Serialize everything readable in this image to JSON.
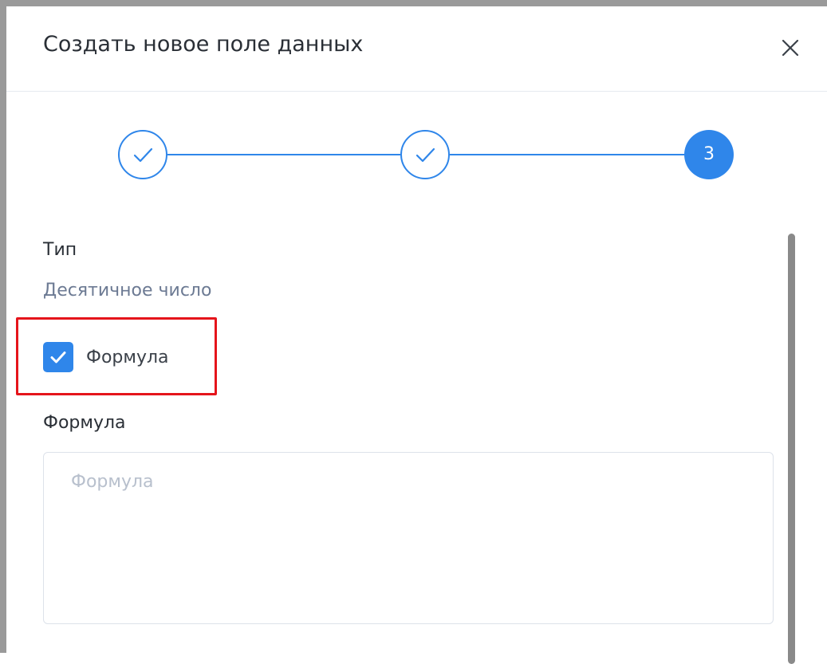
{
  "dialog": {
    "title": "Создать новое поле данных",
    "close_icon": "close-icon"
  },
  "stepper": {
    "steps": [
      {
        "state": "done",
        "icon": "check-icon"
      },
      {
        "state": "done",
        "icon": "check-icon"
      },
      {
        "state": "active",
        "label": "3"
      }
    ],
    "accent_color": "#2f86ea"
  },
  "form": {
    "type_label": "Тип",
    "type_value": "Десятичное число",
    "formula_checkbox": {
      "label": "Формула",
      "checked": true
    },
    "formula_field": {
      "label": "Формула",
      "placeholder": "Формула",
      "value": ""
    }
  },
  "colors": {
    "accent": "#2f86ea",
    "highlight": "#e5141b",
    "muted_text": "#6c7a93"
  }
}
